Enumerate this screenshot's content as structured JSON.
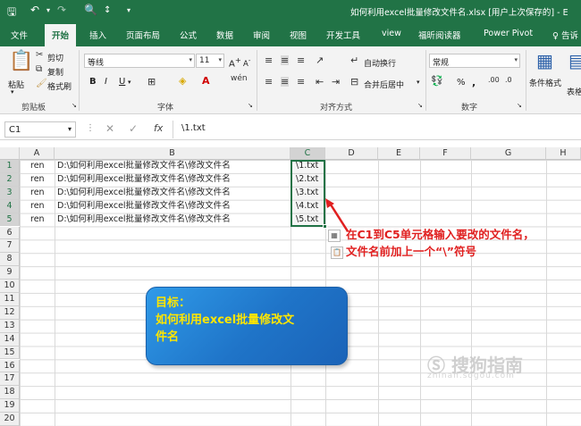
{
  "window": {
    "title": "如何利用excel批量修改文件名.xlsx [用户上次保存的] - E"
  },
  "tabs": [
    "文件",
    "开始",
    "插入",
    "页面布局",
    "公式",
    "数据",
    "审阅",
    "视图",
    "开发工具",
    "view",
    "福昕阅读器",
    "Power Pivot",
    "告诉"
  ],
  "ribbon": {
    "clipboard": {
      "paste": "粘贴",
      "cut": "剪切",
      "copy": "复制",
      "format_painter": "格式刷",
      "label": "剪贴板"
    },
    "font": {
      "name": "等线",
      "size": "11",
      "bold": "B",
      "italic": "I",
      "underline": "U",
      "label": "字体",
      "grow": "A",
      "shrink": "A"
    },
    "alignment": {
      "wrap": "自动换行",
      "merge": "合并后居中",
      "label": "对齐方式"
    },
    "number": {
      "format": "常规",
      "percent": "%",
      "comma": ",",
      "label": "数字"
    },
    "styles": {
      "conditional": "条件格式",
      "table": "表格"
    }
  },
  "formula_bar": {
    "name_box": "C1",
    "fx": "fx",
    "content": "\\1.txt"
  },
  "columns": [
    "A",
    "B",
    "C",
    "D",
    "E",
    "F",
    "G",
    "H"
  ],
  "rows": [
    "1",
    "2",
    "3",
    "4",
    "5",
    "6",
    "7",
    "8",
    "9",
    "10",
    "11",
    "12",
    "13",
    "14",
    "15",
    "16",
    "17",
    "18",
    "19",
    "20"
  ],
  "cells": [
    {
      "a": "ren",
      "b": "D:\\如何利用excel批量修改文件名\\修改文件名",
      "c": "\\1.txt"
    },
    {
      "a": "ren",
      "b": "D:\\如何利用excel批量修改文件名\\修改文件名",
      "c": "\\2.txt"
    },
    {
      "a": "ren",
      "b": "D:\\如何利用excel批量修改文件名\\修改文件名",
      "c": "\\3.txt"
    },
    {
      "a": "ren",
      "b": "D:\\如何利用excel批量修改文件名\\修改文件名",
      "c": "\\4.txt"
    },
    {
      "a": "ren",
      "b": "D:\\如何利用excel批量修改文件名\\修改文件名",
      "c": "\\5.txt"
    }
  ],
  "annotation": {
    "line1": "在C1到C5单元格输入要改的文件名，",
    "line2": "文件名前加上一个“\\”符号",
    "color": "#e02020"
  },
  "callout": {
    "line1": "目标：",
    "line2": "如何利用excel批量修改文",
    "line3": "件名",
    "color": "#ffe600"
  },
  "watermark": {
    "text": "搜狗指南",
    "sub": "zhinan.sogou.com"
  },
  "colors": {
    "accent": "#217346",
    "callout_bg": "#1f74c8"
  }
}
